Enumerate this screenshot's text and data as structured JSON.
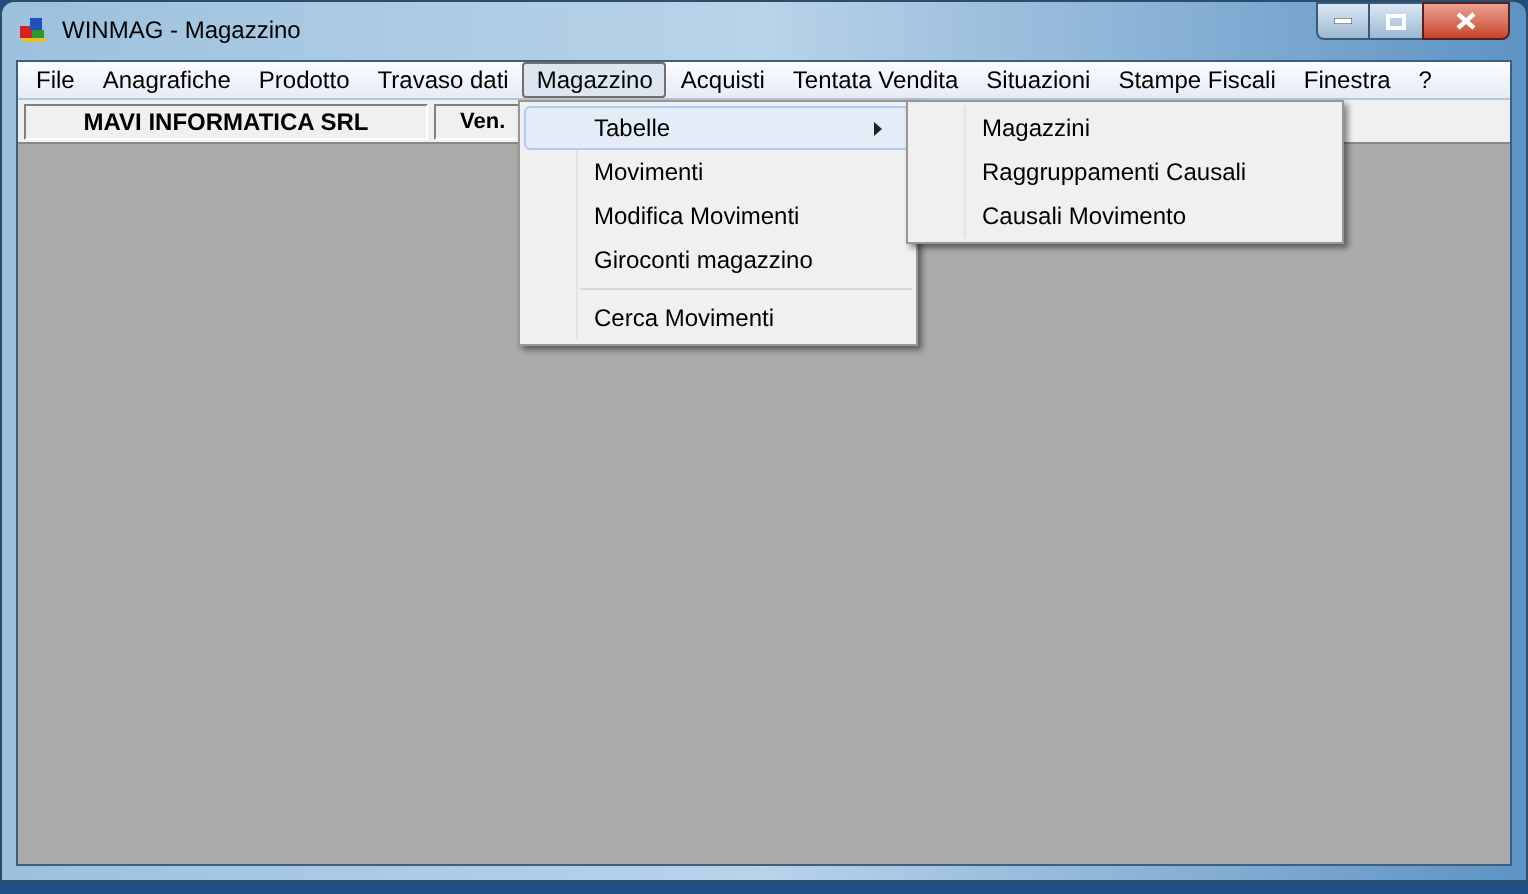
{
  "window": {
    "title": "WINMAG - Magazzino"
  },
  "menu_bar": [
    {
      "label": "File",
      "selected": false
    },
    {
      "label": "Anagrafiche",
      "selected": false
    },
    {
      "label": "Prodotto",
      "selected": false
    },
    {
      "label": "Travaso dati",
      "selected": false
    },
    {
      "label": "Magazzino",
      "selected": true
    },
    {
      "label": "Acquisti",
      "selected": false
    },
    {
      "label": "Tentata Vendita",
      "selected": false
    },
    {
      "label": "Situazioni",
      "selected": false
    },
    {
      "label": "Stampe Fiscali",
      "selected": false
    },
    {
      "label": "Finestra",
      "selected": false
    },
    {
      "label": "?",
      "selected": false
    }
  ],
  "toolbar": {
    "company": "MAVI INFORMATICA SRL",
    "field_2": "Ven."
  },
  "dropdown": [
    {
      "kind": "item",
      "label": "Tabelle",
      "selected": true,
      "submenu": true
    },
    {
      "kind": "item",
      "label": "Movimenti",
      "selected": false,
      "submenu": false
    },
    {
      "kind": "item",
      "label": "Modifica Movimenti",
      "selected": false,
      "submenu": false
    },
    {
      "kind": "item",
      "label": "Giroconti magazzino",
      "selected": false,
      "submenu": false
    },
    {
      "kind": "separator"
    },
    {
      "kind": "item",
      "label": "Cerca Movimenti",
      "selected": false,
      "submenu": false
    }
  ],
  "submenu": [
    {
      "label": "Magazzini",
      "selected": false
    },
    {
      "label": "Raggruppamenti Causali",
      "selected": false
    },
    {
      "label": "Causali Movimento",
      "selected": false
    }
  ]
}
